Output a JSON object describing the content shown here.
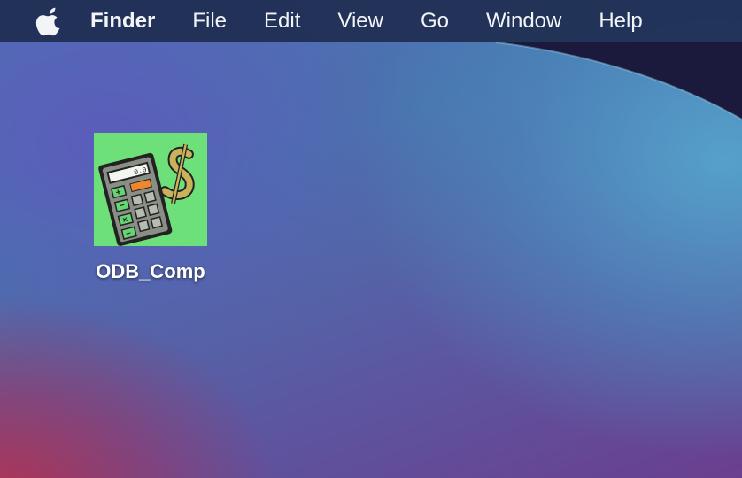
{
  "menubar": {
    "apple_icon": "apple-icon",
    "app_name": "Finder",
    "items": [
      "File",
      "Edit",
      "View",
      "Go",
      "Window",
      "Help"
    ]
  },
  "desktop": {
    "icons": [
      {
        "label": "ODB_Comp",
        "icon": "calculator-dollar-icon",
        "background": "#6ee07a"
      }
    ]
  },
  "colors": {
    "menubar": "#1e2d50",
    "wallpaper_blue": "#4f72b0",
    "wallpaper_red": "#b03050",
    "wallpaper_dark": "#1c1a3a"
  }
}
